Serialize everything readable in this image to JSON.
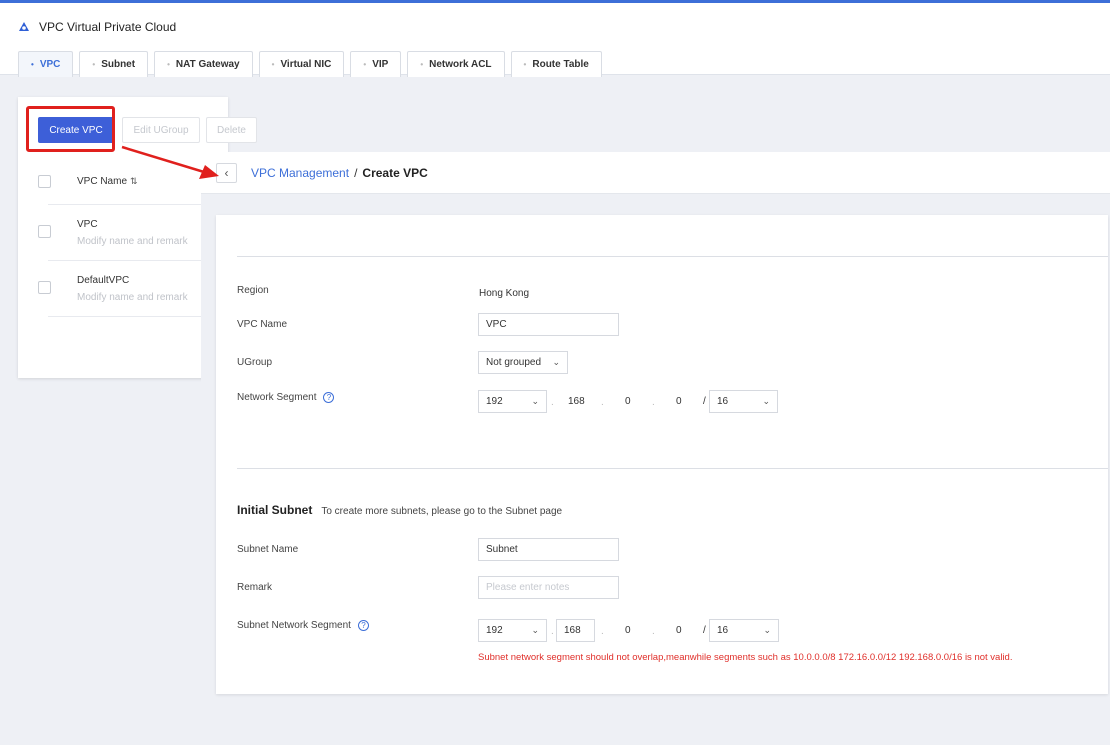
{
  "header": {
    "app_title": "VPC Virtual Private Cloud",
    "app_icon": "cloud-logo-icon",
    "accent_color": "#3d6fd8"
  },
  "tabs": [
    {
      "label": "VPC",
      "active": true
    },
    {
      "label": "Subnet",
      "active": false
    },
    {
      "label": "NAT Gateway",
      "active": false
    },
    {
      "label": "Virtual NIC",
      "active": false
    },
    {
      "label": "VIP",
      "active": false
    },
    {
      "label": "Network ACL",
      "active": false
    },
    {
      "label": "Route Table",
      "active": false
    }
  ],
  "toolbar": {
    "create_label": "Create VPC",
    "edit_ugroup_label": "Edit UGroup",
    "delete_label": "Delete"
  },
  "vpc_list": {
    "column_header": "VPC Name",
    "sort_icon": "sort-icon",
    "rows": [
      {
        "name": "VPC",
        "remark": "Modify name and remark"
      },
      {
        "name": "DefaultVPC",
        "remark": "Modify name and remark"
      }
    ]
  },
  "breadcrumb": {
    "parent": "VPC Management",
    "separator": "/",
    "current": "Create VPC"
  },
  "form": {
    "region_label": "Region",
    "region_value": "Hong Kong",
    "vpc_name_label": "VPC Name",
    "vpc_name_value": "VPC",
    "ugroup_label": "UGroup",
    "ugroup_value": "Not grouped",
    "network_segment_label": "Network Segment",
    "network_segment": {
      "octet1": "192",
      "octet2": "168",
      "octet3": "0",
      "octet4": "0",
      "slash": "/",
      "mask": "16"
    }
  },
  "subnet": {
    "title": "Initial Subnet",
    "hint": "To create more subnets, please go to the Subnet page",
    "name_label": "Subnet Name",
    "name_value": "Subnet",
    "remark_label": "Remark",
    "remark_placeholder": "Please enter notes",
    "segment_label": "Subnet Network Segment",
    "segment": {
      "octet1": "192",
      "octet2": "168",
      "octet3": "0",
      "octet4": "0",
      "slash": "/",
      "mask": "16"
    },
    "error": "Subnet network segment should not overlap,meanwhile segments such as 10.0.0.0/8 172.16.0.0/12 192.168.0.0/16 is not valid."
  },
  "annotation": {
    "highlight_color": "#e0201d"
  }
}
